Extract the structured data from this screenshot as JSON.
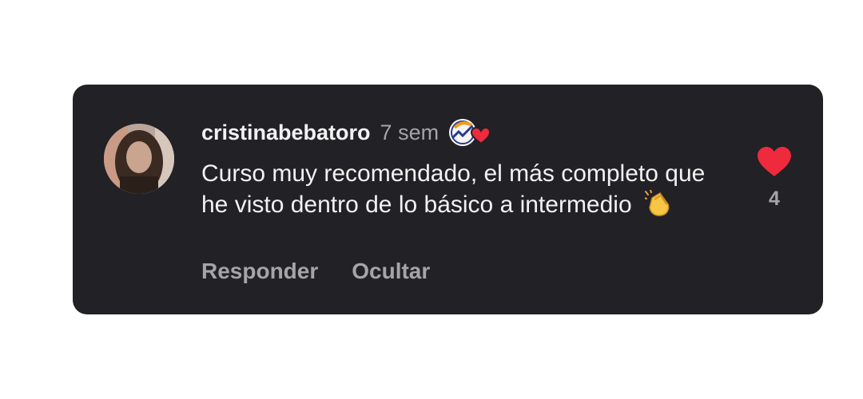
{
  "comment": {
    "username": "cristinabebatoro",
    "time": "7 sem",
    "text": "Curso muy recomendado, el más completo que he visto dentro de lo básico a intermedio",
    "emoji_icon": "clapping-hands-icon",
    "creator_badge_icon": "creator-liked-badge-icon",
    "likes": "4"
  },
  "actions": {
    "reply_label": "Responder",
    "hide_label": "Ocultar"
  },
  "colors": {
    "card_bg": "#212126",
    "heart": "#ee2a3c",
    "muted_text": "#a4a4a9",
    "primary_text": "#f2f2f2"
  }
}
